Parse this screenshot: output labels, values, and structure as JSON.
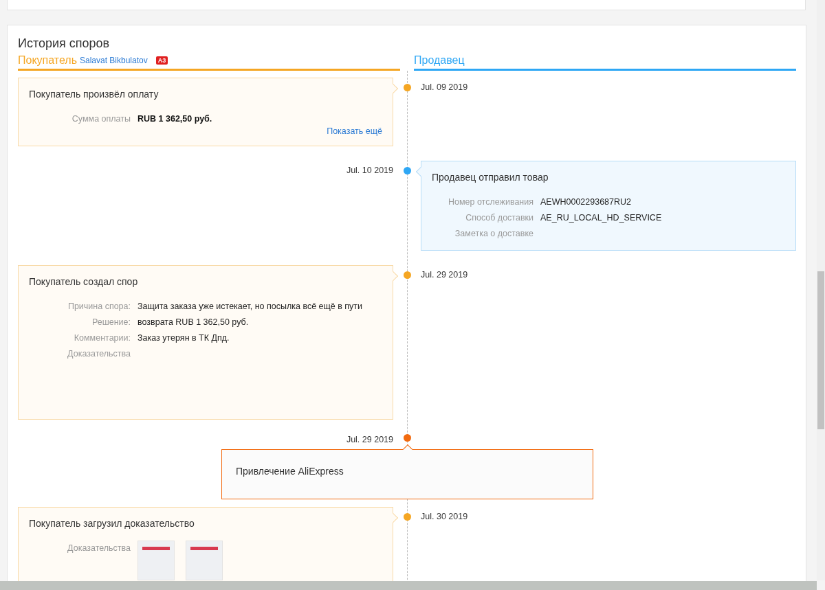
{
  "section_title": "История споров",
  "buyer_header": {
    "label": "Покупатель",
    "name": "Salavat Bikbulatov",
    "badge": "A3"
  },
  "seller_header": {
    "label": "Продавец"
  },
  "events": [
    {
      "kind": "buyer",
      "date": "Jul. 09 2019",
      "title": "Покупатель произвёл оплату",
      "fields": [
        {
          "kind": "text",
          "label": "Сумма оплаты",
          "value": "RUB 1 362,50 руб.",
          "strong": true
        }
      ],
      "link": "Показать ещё"
    },
    {
      "kind": "seller",
      "date": "Jul. 10 2019",
      "title": "Продавец отправил товар",
      "fields": [
        {
          "label": "Номер отслеживания",
          "value": "AEWH0002293687RU2",
          "strong": false
        },
        {
          "label": "Способ доставки",
          "value": "AE_RU_LOCAL_HD_SERVICE",
          "strong": false
        },
        {
          "label": "Заметка о доставке"
        }
      ]
    },
    {
      "kind": "buyer",
      "date": "Jul. 29 2019",
      "title": "Покупатель создал спор",
      "fields": [
        {
          "kind": "text",
          "label": "Причина спора:",
          "value": "Защита заказа уже истекает, но посылка всё ещё в пути",
          "strong": false
        },
        {
          "kind": "text",
          "label": "Решение:",
          "value": "возврата RUB 1 362,50 руб.",
          "strong": false
        },
        {
          "kind": "text",
          "label": "Комментарии:",
          "value": "Заказ утерян в ТК Дпд.",
          "strong": false
        },
        {
          "kind": "evidence",
          "label": "Доказательства"
        }
      ]
    },
    {
      "kind": "platform",
      "date": "Jul. 29 2019",
      "title": "Привлечение AliExpress"
    },
    {
      "kind": "buyer",
      "date": "Jul. 30 2019",
      "title": "Покупатель загрузил доказательство",
      "fields": [
        {
          "kind": "evidence",
          "label": "Доказательства",
          "images": [
            {
              "kind": "document"
            },
            {
              "kind": "document"
            }
          ]
        }
      ]
    }
  ]
}
